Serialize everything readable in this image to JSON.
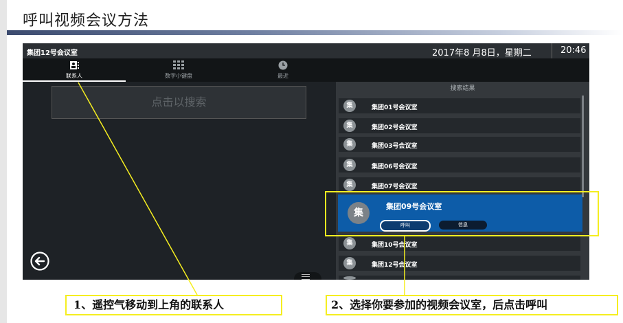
{
  "slide": {
    "title": "呼叫视频会议方法"
  },
  "device": {
    "room_name": "集团12号会议室",
    "date": "2017年8 月8日，星期二",
    "time": "20:46"
  },
  "tabs": [
    {
      "label": "联系人",
      "icon": "contacts-icon"
    },
    {
      "label": "数字小键盘",
      "icon": "keypad-icon"
    },
    {
      "label": "最近",
      "icon": "clock-icon"
    }
  ],
  "search": {
    "placeholder": "点击以搜索"
  },
  "results": {
    "header": "搜索结果",
    "avatar_char": "集",
    "items": [
      "集团01号会议室",
      "集团02号会议室",
      "集团03号会议室",
      "集团06号会议室",
      "集团07号会议室",
      "集团09号会议室",
      "集团10号会议室",
      "集团12号会议室"
    ],
    "selected": {
      "name": "集团09号会议室",
      "call_label": "呼叫",
      "info_label": "信息"
    }
  },
  "annotations": {
    "step1": "1、遥控气移动到上角的联系人",
    "step2": "2、选择你要参加的视频会议室，后点击呼叫",
    "color": "#f5ee20"
  }
}
